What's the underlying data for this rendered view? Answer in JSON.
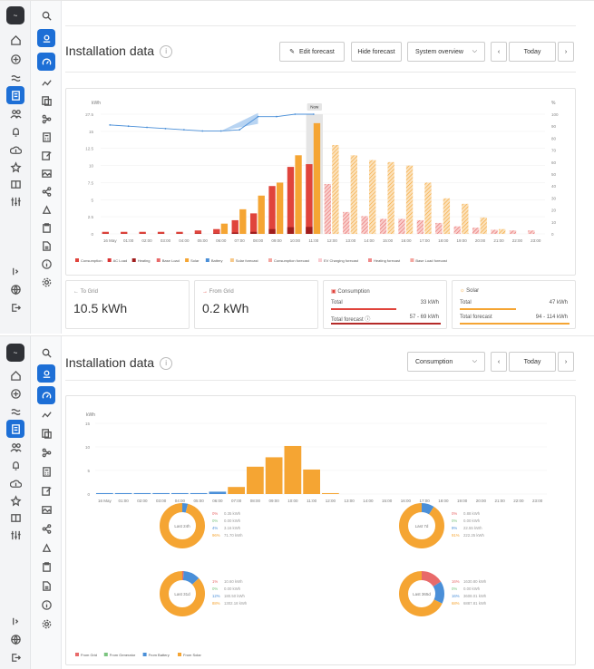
{
  "frames": [
    {
      "title": "Installation data",
      "buttons": {
        "edit_forecast": "Edit forecast",
        "hide_forecast": "Hide forecast",
        "view_select": "System overview",
        "today": "Today"
      },
      "chart_data": {
        "type": "bar",
        "y_left_label": "kWh",
        "y_right_label": "%",
        "left_ticks": [
          "27.5",
          "15",
          "12.5",
          "10",
          "7.5",
          "5",
          "2.5",
          "0"
        ],
        "right_ticks": [
          "100",
          "90",
          "80",
          "70",
          "60",
          "50",
          "40",
          "30",
          "20",
          "10",
          "0"
        ],
        "now_label": "Now",
        "x_labels": [
          "16 May",
          "01:00",
          "02:00",
          "03:00",
          "04:00",
          "05:00",
          "06:00",
          "07:00",
          "08:00",
          "09:00",
          "10:00",
          "11:00",
          "12:00",
          "13:00",
          "14:00",
          "15:00",
          "16:00",
          "17:00",
          "18:00",
          "19:00",
          "20:00",
          "21:00",
          "22:00",
          "23:00"
        ],
        "consumption": [
          0.3,
          0.3,
          0.3,
          0.3,
          0.3,
          0.5,
          0.7,
          2.0,
          3.0,
          7.0,
          9.8,
          10.2,
          7.3,
          3.2,
          2.6,
          2.2,
          2.2,
          2.0,
          1.6,
          1.1,
          0.9,
          0.6,
          0.5,
          0.5
        ],
        "solar": [
          0,
          0,
          0,
          0,
          0,
          0,
          1.5,
          3.6,
          5.6,
          7.5,
          11.5,
          16.2,
          0,
          0,
          0,
          0,
          0,
          0,
          0,
          0,
          0,
          0,
          0,
          0
        ],
        "solar_forecast": [
          0,
          0,
          0,
          0,
          0,
          0,
          0,
          0,
          0,
          0,
          0,
          0,
          13.0,
          11.5,
          10.8,
          10.5,
          10.0,
          7.5,
          5.2,
          4.4,
          2.4,
          0.7,
          0,
          0
        ],
        "soc_percent": [
          91,
          90,
          89,
          88,
          87,
          86,
          86,
          87,
          98,
          98,
          100,
          100
        ],
        "legend": [
          "Consumption",
          "AC Load",
          "Heating",
          "Base Load",
          "Solar",
          "Battery",
          "Solar forecast",
          "Consumption forecast",
          "EV Charging forecast",
          "Heating forecast",
          "Base Load forecast"
        ]
      },
      "stats": {
        "to_grid": {
          "label": "To Grid",
          "value": "10.5 kWh"
        },
        "from_grid": {
          "label": "From Grid",
          "value": "0.2 kWh"
        },
        "consumption": {
          "label": "Consumption",
          "total_label": "Total",
          "total": "33 kWh",
          "forecast_label": "Total forecast",
          "forecast": "57 - 69 kWh"
        },
        "solar": {
          "label": "Solar",
          "total_label": "Total",
          "total": "47 kWh",
          "forecast_label": "Total forecast",
          "forecast": "94 - 114 kWh"
        }
      }
    },
    {
      "title": "Installation data",
      "buttons": {
        "view_select": "Consumption",
        "today": "Today"
      },
      "chart_data": {
        "type": "bar",
        "ylabel": "kWh",
        "y_ticks": [
          "15",
          "10",
          "5",
          "0"
        ],
        "x_labels": [
          "16 May",
          "01:00",
          "02:00",
          "03:00",
          "04:00",
          "05:00",
          "06:00",
          "07:00",
          "08:00",
          "09:00",
          "10:00",
          "11:00",
          "12:00",
          "13:00",
          "14:00",
          "15:00",
          "16:00",
          "17:00",
          "18:00",
          "19:00",
          "20:00",
          "21:00",
          "22:00",
          "23:00"
        ],
        "values": [
          0.2,
          0.2,
          0.2,
          0.2,
          0.2,
          0.2,
          0.5,
          1.5,
          5.8,
          7.8,
          10.2,
          5.2,
          0.2,
          0,
          0,
          0,
          0,
          0,
          0,
          0,
          0,
          0,
          0,
          0
        ]
      },
      "donuts": [
        {
          "label": "Last 24h",
          "rows": [
            {
              "pct": "0%",
              "val": "0.35 kWh",
              "color": "#e86a6a"
            },
            {
              "pct": "0%",
              "val": "0.00 kWh",
              "color": "#7bc47f"
            },
            {
              "pct": "4%",
              "val": "3.16 kWh",
              "color": "#4a8fd8"
            },
            {
              "pct": "96%",
              "val": "71.70 kWh",
              "color": "#f5a533"
            }
          ]
        },
        {
          "label": "Last 7d",
          "rows": [
            {
              "pct": "0%",
              "val": "0.88 kWh",
              "color": "#e86a6a"
            },
            {
              "pct": "0%",
              "val": "0.00 kWh",
              "color": "#7bc47f"
            },
            {
              "pct": "9%",
              "val": "22.55 kWh",
              "color": "#4a8fd8"
            },
            {
              "pct": "91%",
              "val": "222.25 kWh",
              "color": "#f5a533"
            }
          ]
        },
        {
          "label": "Last 31d",
          "rows": [
            {
              "pct": "1%",
              "val": "10.60 kWh",
              "color": "#e86a6a"
            },
            {
              "pct": "0%",
              "val": "0.00 kWh",
              "color": "#7bc47f"
            },
            {
              "pct": "12%",
              "val": "180.50 kWh",
              "color": "#4a8fd8"
            },
            {
              "pct": "88%",
              "val": "1302.18 kWh",
              "color": "#f5a533"
            }
          ]
        },
        {
          "label": "Last 365d",
          "rows": [
            {
              "pct": "16%",
              "val": "1630.80 kWh",
              "color": "#e86a6a"
            },
            {
              "pct": "0%",
              "val": "0.00 kWh",
              "color": "#7bc47f"
            },
            {
              "pct": "16%",
              "val": "3608.01 kWh",
              "color": "#4a8fd8"
            },
            {
              "pct": "68%",
              "val": "6887.81 kWh",
              "color": "#f5a533"
            }
          ]
        }
      ],
      "legend": [
        "From Grid",
        "From Generator",
        "From Battery",
        "From Solar"
      ]
    }
  ],
  "colors": {
    "consumption": "#e0443c",
    "solar": "#f5a533",
    "solar_forecast": "#f7c98a",
    "battery": "#4a8fd8",
    "accent": "#1d6fd6"
  }
}
